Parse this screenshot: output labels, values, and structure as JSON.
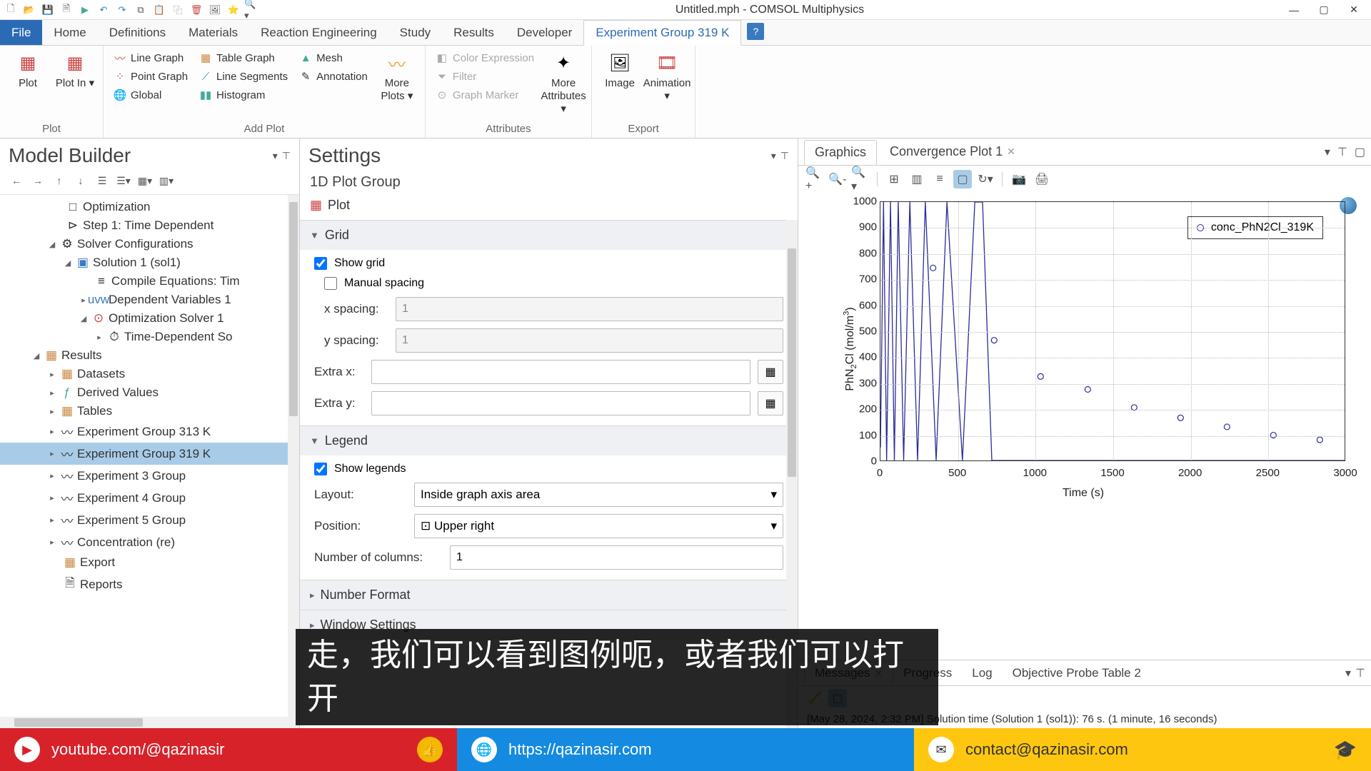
{
  "titlebar": {
    "title": "Untitled.mph - COMSOL Multiphysics"
  },
  "menu": {
    "file": "File",
    "items": [
      "Home",
      "Definitions",
      "Materials",
      "Reaction Engineering",
      "Study",
      "Results",
      "Developer"
    ],
    "active": "Experiment Group 319 K"
  },
  "ribbon": {
    "plot": {
      "plot": "Plot",
      "plotin": "Plot\nIn",
      "group": "Plot"
    },
    "addplot": {
      "line_graph": "Line Graph",
      "point_graph": "Point Graph",
      "global": "Global",
      "table_graph": "Table Graph",
      "line_segments": "Line Segments",
      "histogram": "Histogram",
      "mesh": "Mesh",
      "annotation": "Annotation",
      "more_plots": "More\nPlots",
      "group": "Add Plot"
    },
    "attributes": {
      "color_expr": "Color Expression",
      "filter": "Filter",
      "graph_marker": "Graph Marker",
      "more_attr": "More\nAttributes",
      "group": "Attributes"
    },
    "export": {
      "image": "Image",
      "animation": "Animation",
      "group": "Export"
    }
  },
  "model_builder": {
    "title": "Model Builder",
    "tree": {
      "optimization": "Optimization",
      "step1": "Step 1: Time Dependent",
      "solver_conf": "Solver Configurations",
      "solution1": "Solution 1 (sol1)",
      "compile_eq": "Compile Equations: Tim",
      "dep_vars": "Dependent Variables 1",
      "opt_solver": "Optimization Solver 1",
      "time_dep": "Time-Dependent So",
      "results": "Results",
      "datasets": "Datasets",
      "derived": "Derived Values",
      "tables": "Tables",
      "exp313": "Experiment Group 313 K",
      "exp319": "Experiment Group 319 K",
      "exp3": "Experiment 3 Group",
      "exp4": "Experiment 4 Group",
      "exp5": "Experiment 5 Group",
      "conc": "Concentration (re)",
      "export": "Export",
      "reports": "Reports"
    }
  },
  "settings": {
    "title": "Settings",
    "subtitle": "1D Plot Group",
    "plot_btn": "Plot",
    "grid": {
      "header": "Grid",
      "show_grid": "Show grid",
      "manual": "Manual spacing",
      "x_spacing_label": "x spacing:",
      "x_spacing": "1",
      "y_spacing_label": "y spacing:",
      "y_spacing": "1",
      "extra_x_label": "Extra x:",
      "extra_x": "",
      "extra_y_label": "Extra y:",
      "extra_y": ""
    },
    "legend": {
      "header": "Legend",
      "show_legends": "Show legends",
      "layout_label": "Layout:",
      "layout": "Inside graph axis area",
      "position_label": "Position:",
      "position": "Upper right",
      "numcols_label": "Number of columns:",
      "numcols": "1"
    },
    "number_format": "Number Format",
    "window_settings": "Window Settings"
  },
  "graphics": {
    "tabs": {
      "graphics": "Graphics",
      "conv": "Convergence Plot 1"
    }
  },
  "chart_data": {
    "type": "line+scatter",
    "xlabel": "Time (s)",
    "ylabel": "PhN₂Cl (mol/m³)",
    "xlim": [
      0,
      3000
    ],
    "ylim": [
      0,
      1000
    ],
    "xticks": [
      0,
      500,
      1000,
      1500,
      2000,
      2500,
      3000
    ],
    "yticks": [
      0,
      100,
      200,
      300,
      400,
      500,
      600,
      700,
      800,
      900,
      1000
    ],
    "legend": "conc_PhN2Cl_319K",
    "legend_position": "upper right",
    "line_series": {
      "description": "oscillatory solution between 0 and 1000 from t≈0 to t≈750 then flat at 0",
      "segments": [
        {
          "x": 0,
          "y": 50
        },
        {
          "x": 20,
          "y": 1000
        },
        {
          "x": 40,
          "y": 0
        },
        {
          "x": 65,
          "y": 1000
        },
        {
          "x": 90,
          "y": 0
        },
        {
          "x": 115,
          "y": 1000
        },
        {
          "x": 150,
          "y": 0
        },
        {
          "x": 190,
          "y": 1000
        },
        {
          "x": 240,
          "y": 0
        },
        {
          "x": 290,
          "y": 1000
        },
        {
          "x": 360,
          "y": 0
        },
        {
          "x": 430,
          "y": 1000
        },
        {
          "x": 530,
          "y": 0
        },
        {
          "x": 610,
          "y": 1000
        },
        {
          "x": 660,
          "y": 1000
        },
        {
          "x": 720,
          "y": 0
        },
        {
          "x": 3000,
          "y": 0
        }
      ]
    },
    "scatter_series": [
      {
        "x": 340,
        "y": 745
      },
      {
        "x": 735,
        "y": 465
      },
      {
        "x": 1035,
        "y": 325
      },
      {
        "x": 1340,
        "y": 275
      },
      {
        "x": 1640,
        "y": 205
      },
      {
        "x": 1940,
        "y": 165
      },
      {
        "x": 2240,
        "y": 130
      },
      {
        "x": 2540,
        "y": 98
      },
      {
        "x": 2840,
        "y": 80
      }
    ]
  },
  "messages": {
    "tabs": {
      "messages": "Messages",
      "progress": "Progress",
      "log": "Log",
      "probe": "Objective Probe Table 2"
    },
    "text": "[May 28, 2024, 2:32 PM] Solution time (Solution 1 (sol1)): 76 s. (1 minute, 16 seconds)"
  },
  "subtitle": "走，我们可以看到图例呃，或者我们可以打开",
  "bottombar": {
    "youtube": "youtube.com/@qazinasir",
    "site": "https://qazinasir.com",
    "email": "contact@qazinasir.com"
  }
}
